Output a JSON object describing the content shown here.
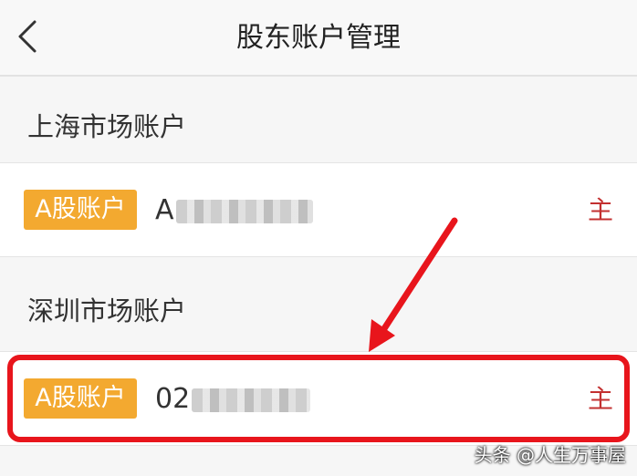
{
  "header": {
    "title": "股东账户管理",
    "back_icon": "chevron-left-icon"
  },
  "sections": [
    {
      "title": "上海市场账户",
      "account": {
        "badge": "A股账户",
        "number_prefix": "A",
        "tag": "主"
      }
    },
    {
      "title": "深圳市场账户",
      "account": {
        "badge": "A股账户",
        "number_prefix": "02",
        "tag": "主"
      }
    }
  ],
  "annotation": {
    "color": "#e8151c"
  },
  "colors": {
    "badge": "#f3a930",
    "tag": "#c33030"
  },
  "watermark": "头条 @人生万事屋"
}
